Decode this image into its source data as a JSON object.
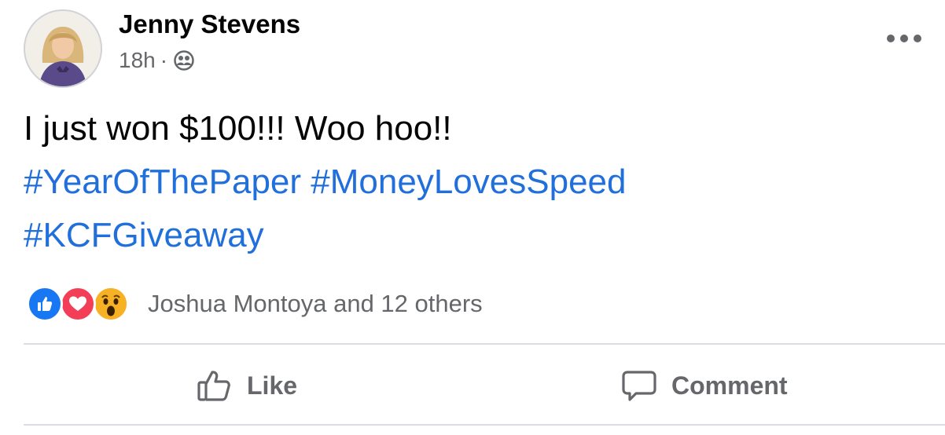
{
  "post": {
    "author": {
      "name": "Jenny Stevens",
      "avatar_icon": "profile-photo"
    },
    "meta": {
      "timestamp": "18h",
      "separator": "·",
      "privacy_icon": "friends-icon"
    },
    "more_icon": "more-horizontal-icon",
    "text": {
      "line1": "I just won $100!!! Woo hoo!!",
      "hashtags": [
        "#YearOfThePaper",
        "#MoneyLovesSpeed",
        "#KCFGiveaway"
      ]
    },
    "reactions": {
      "types": [
        "like",
        "love",
        "wow"
      ],
      "summary": "Joshua Montoya and 12 others"
    },
    "actions": {
      "like_label": "Like",
      "comment_label": "Comment"
    }
  },
  "colors": {
    "hashtag": "#216fdb",
    "secondary_text": "#65676b",
    "like": "#1877f2",
    "love": "#f33e58",
    "wow": "#f7b125",
    "divider": "#dadde1"
  }
}
